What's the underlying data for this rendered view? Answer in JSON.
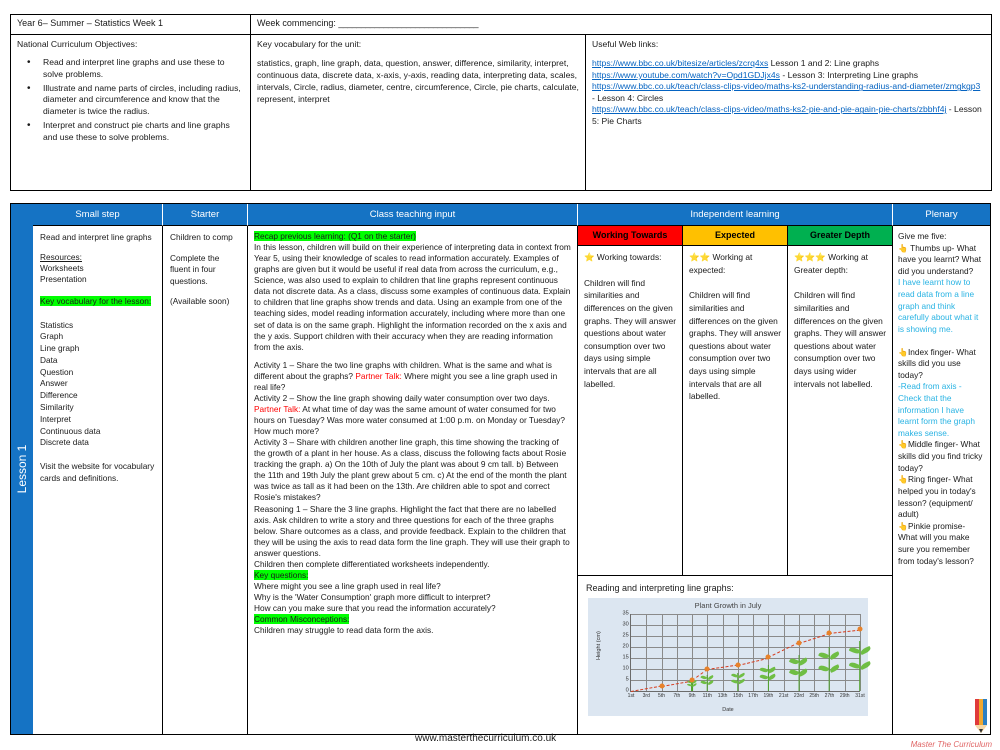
{
  "header": {
    "title": "Year 6– Summer – Statistics  Week 1",
    "week_commencing_label": "Week commencing:",
    "week_commencing_blank": "_______________________________",
    "nc_heading": "National Curriculum Objectives:",
    "nc_objectives": [
      "Read and interpret line graphs and use these to solve problems.",
      "Illustrate and name parts of circles, including radius, diameter and circumference and know that the diameter is twice the radius.",
      "Interpret and construct pie charts and line graphs and use these to solve problems."
    ],
    "vocab_heading": "Key vocabulary for the unit:",
    "vocab_body": "statistics, graph, line graph, data, question, answer, difference, similarity, interpret, continuous data, discrete data, x-axis, y-axis, reading data, interpreting data, scales, intervals, Circle, radius, diameter, centre, circumference, Circle, pie charts, calculate, represent, interpret",
    "links_heading": "Useful Web links:",
    "links": [
      {
        "url": "https://www.bbc.co.uk/bitesize/articles/zcrq4xs",
        "suffix": "  Lesson 1 and 2: Line graphs"
      },
      {
        "url": "https://www.youtube.com/watch?v=Opd1GDJjx4s",
        "suffix": " - Lesson 3: Interpreting Line graphs"
      },
      {
        "url": "https://www.bbc.co.uk/teach/class-clips-video/maths-ks2-understanding-radius-and-diameter/zmgkgp3",
        "suffix": " - Lesson 4: Circles"
      },
      {
        "url": "https://www.bbc.co.uk/teach/class-clips-video/maths-ks2-pie-and-pie-again-pie-charts/zbbhf4j",
        "suffix": " - Lesson 5: Pie Charts"
      }
    ]
  },
  "lesson_tab": "Lesson 1",
  "columns": {
    "small_step": "Small step",
    "starter": "Starter",
    "class_teaching": "Class teaching input",
    "independent": "Independent learning",
    "plenary": "Plenary"
  },
  "small_step": {
    "title": "Read and interpret line graphs",
    "resources_heading": "Resources:",
    "resources": [
      "Worksheets",
      "Presentation"
    ],
    "key_vocab_heading": "Key vocabulary for the lesson:",
    "vocabulary": [
      "Statistics",
      "Graph",
      "Line graph",
      "Data",
      "Question",
      "Answer",
      "Difference",
      "Similarity",
      "Interpret",
      "Continuous data",
      "Discrete data"
    ],
    "footer_note": "Visit the website for vocabulary cards and definitions."
  },
  "starter": {
    "lines": [
      "Children to comp",
      "Complete the fluent in four questions.",
      "(Available soon)"
    ]
  },
  "teaching": {
    "recap_heading": "Recap previous learning: (Q1 on the starter)",
    "recap_body": "In this lesson, children will build on their experience of interpreting data in context from Year 5, using their knowledge of scales to read information accurately. Examples of graphs are given but it would be useful if real data from across the curriculum, e.g., Science, was also used to explain to children that line graphs represent continuous data not discrete data. As a class, discuss some examples of continuous data. Explain to children that line graphs show trends and data. Using an example from one of the teaching sides,  model reading information accurately, including where more than one set of  data is on the same graph. Highlight the  information recorded on the x axis and the y axis. Support children with their accuracy when they are reading information from the axis.",
    "activity1_pre": "Activity 1 – Share the two line graphs with children. What is the same and what is different about the graphs? ",
    "activity1_red": "Partner Talk:",
    "activity1_post": "  Where might you see a line graph used in real life?",
    "activity2_pre": "Activity 2 – Show the line graph showing daily water consumption over two days. ",
    "activity2_red": "Partner Talk:",
    "activity2_post": " At what time of day was the same amount of water consumed for two hours on Tuesday? Was more water consumed at 1:00 p.m. on Monday or Tuesday? How much more?",
    "activity3": "Activity 3 – Share with children another line graph, this time showing the tracking of the growth of a plant in her house. As a class, discuss the following facts about Rosie tracking the graph. a) On the 10th of July the plant was about 9 cm tall. b) Between the 11th and 19th July the plant grew about 5 cm. c) At the end of the month the plant was twice as tall as it had been on the 13th. Are children able to spot and correct Rosie's mistakes?",
    "reasoning": "Reasoning 1 – Share the 3 line graphs. Highlight the fact that there are no labelled axis. Ask children to write a story and three questions for each of the three graphs below. Share outcomes as a class, and provide feedback. Explain to the children that they will be using the axis to read data form the line graph. They will use their graph to answer questions.",
    "worksheets_line": "Children then complete differentiated worksheets independently.",
    "key_questions_heading": "Key questions:",
    "key_questions": [
      "Where might you see a line graph used in real life?",
      "Why is the 'Water Consumption' graph more difficult to interpret?",
      "How can you make sure that you read the information accurately?"
    ],
    "misconceptions_heading": "Common Misconceptions:",
    "misconceptions_body": "Children may struggle to read data form the axis."
  },
  "independent": {
    "levels": [
      {
        "label": "Working Towards",
        "color": "#ff0000",
        "stars": "⭐",
        "lead": "Working towards:",
        "text": "Children will find similarities and differences on the given graphs. They will answer questions about water consumption over two days using simple intervals that are all labelled."
      },
      {
        "label": "Expected",
        "color": "#ffc000",
        "stars": "⭐⭐",
        "lead": "Working at expected:",
        "text": "Children will find similarities and differences on the given graphs. They will answer questions about water consumption over two days using simple intervals that are all labelled."
      },
      {
        "label": "Greater Depth",
        "color": "#00b050",
        "stars": "⭐⭐⭐",
        "lead": "Working at Greater depth:",
        "text": "Children will find similarities and differences on the given graphs. They will answer questions about water consumption over two days using wider intervals not labelled."
      }
    ],
    "graph_caption": "Reading and interpreting line graphs:"
  },
  "plenary": {
    "heading": "Give me five:",
    "items": [
      {
        "icon": "hand-thumbs-up",
        "black": "Thumbs up- What have you learnt? What did you understand?",
        "cyan": "I have learnt how to read data from a line graph and think carefully about what it is showing me."
      },
      {
        "icon": "hand-index-finger",
        "black": "Index finger- What skills did you use today?",
        "cyan": "-Read from axis -Check that the information I have learnt form the graph  makes sense."
      },
      {
        "icon": "hand-middle-finger",
        "black": "Middle finger- What skills did you find tricky today?",
        "cyan": ""
      },
      {
        "icon": "hand-ring-finger",
        "black": "Ring finger- What helped you in today's lesson? (equipment/ adult)",
        "cyan": ""
      },
      {
        "icon": "hand-pinkie",
        "black": "Pinkie promise- What will you make sure you remember from today's lesson?",
        "cyan": ""
      }
    ]
  },
  "footer": {
    "site": "www.masterthecurriculum.co.uk",
    "brand": "Master The Curriculum"
  },
  "chart_data": {
    "type": "line",
    "title": "Plant Growth in July",
    "xlabel": "Date",
    "ylabel": "Height (cm)",
    "ylim": [
      0,
      35
    ],
    "yticks": [
      0,
      5,
      10,
      15,
      20,
      25,
      30,
      35
    ],
    "xticks": [
      "1st",
      "3rd",
      "5th",
      "7th",
      "9th",
      "11th",
      "13th",
      "15th",
      "17th",
      "19th",
      "21st",
      "23rd",
      "25th",
      "27th",
      "29th",
      "31st"
    ],
    "x": [
      1,
      5,
      9,
      11,
      15,
      19,
      23,
      27,
      31
    ],
    "values": [
      0,
      2.5,
      5,
      10,
      12,
      15.3,
      22,
      26.5,
      28
    ],
    "grid": true,
    "legend": "none",
    "line_style": "dashed",
    "line_color": "#d63c1e",
    "marker_color": "#e8822a",
    "background": "#dce6f1"
  }
}
